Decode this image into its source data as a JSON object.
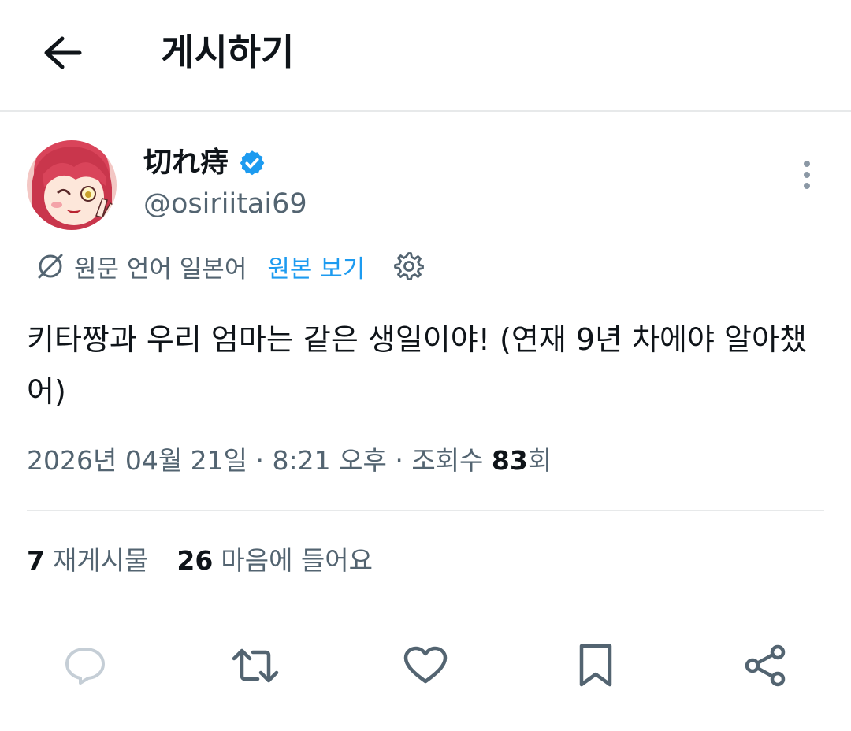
{
  "header": {
    "back_icon": "arrow-left-icon",
    "title": "게시하기"
  },
  "author": {
    "avatar_icon": "anime-avatar",
    "display_name": "切れ痔",
    "verified_icon": "verified-badge-icon",
    "verified_color": "#1d9bf0",
    "handle": "@osiriitai69",
    "more_icon": "more-vertical-icon"
  },
  "translation": {
    "icon": "translate-slash-icon",
    "language_text": "원문 언어 일본어",
    "show_original_label": "원본 보기",
    "settings_icon": "gear-icon"
  },
  "tweet": {
    "text": "키타짱과 우리 엄마는 같은 생일이야! (연재 9년 차에야 알아챘어)"
  },
  "meta": {
    "date": "2026년 04월 21일",
    "time": "8:21 오후",
    "views_prefix": "조회수",
    "views_count": "83",
    "views_suffix": "회"
  },
  "stats": {
    "reposts_count": "7",
    "reposts_label": "재게시물",
    "likes_count": "26",
    "likes_label": "마음에 들어요"
  },
  "actions": {
    "reply_icon": "reply-icon",
    "repost_icon": "repost-icon",
    "like_icon": "heart-icon",
    "bookmark_icon": "bookmark-icon",
    "share_icon": "share-icon"
  },
  "colors": {
    "text_primary": "#0f1419",
    "text_secondary": "#536471",
    "accent": "#1d9bf0",
    "divider": "#e7e9ea"
  }
}
